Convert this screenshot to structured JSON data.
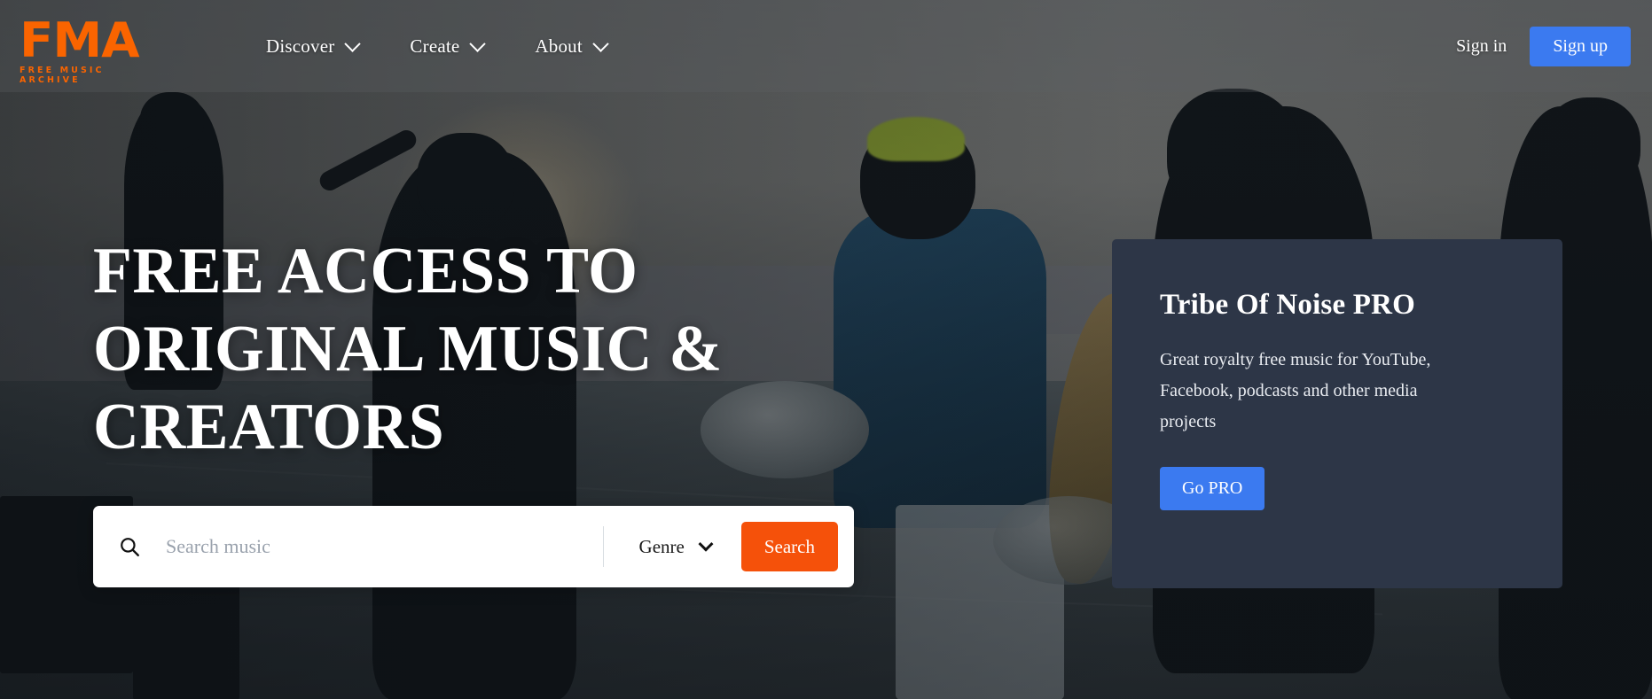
{
  "brand": {
    "logo_mark": "FMA",
    "logo_sub": "FREE MUSIC ARCHIVE",
    "logo_color": "#fa6400"
  },
  "header": {
    "nav": [
      {
        "label": "Discover",
        "icon": "chevron-down-icon"
      },
      {
        "label": "Create",
        "icon": "chevron-down-icon"
      },
      {
        "label": "About",
        "icon": "chevron-down-icon"
      }
    ],
    "sign_in_label": "Sign in",
    "sign_up_label": "Sign up",
    "sign_up_color": "#3b7af0"
  },
  "hero": {
    "title_line_1": "FREE ACCESS TO",
    "title_line_2": "ORIGINAL MUSIC &",
    "title_line_3": "CREATORS"
  },
  "search": {
    "icon": "search-icon",
    "placeholder": "Search music",
    "value": "",
    "genre_label": "Genre",
    "genre_icon": "chevron-down-icon",
    "button_label": "Search",
    "button_color": "#f5510a"
  },
  "pro_card": {
    "title": "Tribe Of Noise PRO",
    "description": "Great royalty free music for YouTube, Facebook, podcasts and other media projects",
    "button_label": "Go PRO",
    "button_color": "#3b7af0",
    "background_color": "#2d3647"
  }
}
